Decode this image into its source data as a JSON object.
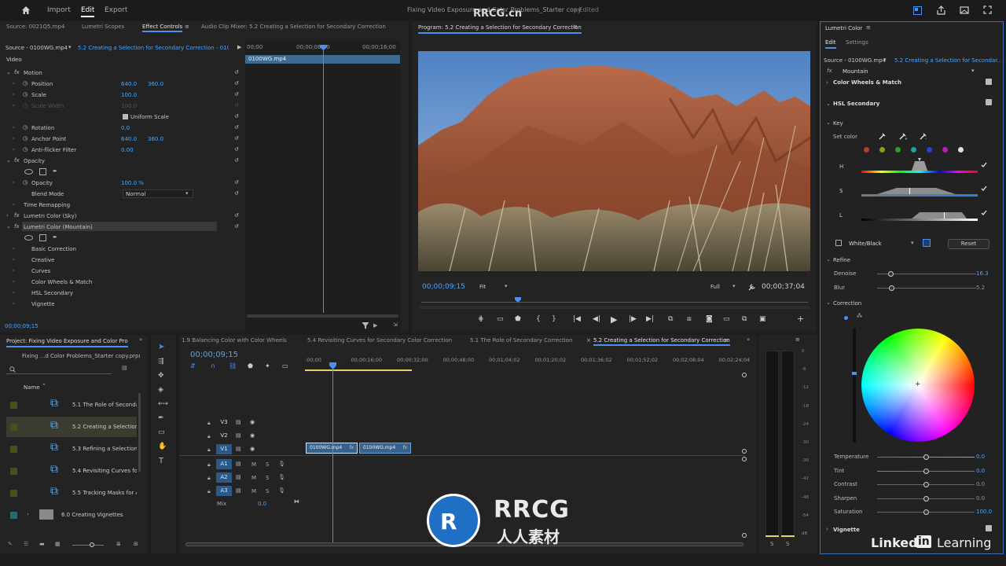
{
  "topbar": {
    "tabs": [
      "Import",
      "Edit",
      "Export"
    ],
    "active_tab": "Edit",
    "title": "Fixing Video Exposure and Color Problems_Starter copy",
    "title_status": "- Edited",
    "watermark": "RRCG.cn"
  },
  "source_panel": {
    "tabs": [
      "Source: 0021Q5.mp4",
      "Lumetri Scopes",
      "Effect Controls",
      "Audio Clip Mixer: 5.2 Creating a Selection for Secondary Correction"
    ],
    "active_tab": "Effect Controls",
    "source_label": "Source - 0100WG.mp4",
    "sequence_label": "5.2 Creating a Selection for Secondary Correction - 0100...",
    "ruler": [
      "00;00",
      "00;00;08;00",
      "00;00;16;00"
    ],
    "clip_name": "0100WG.mp4",
    "section_video": "Video",
    "rows": [
      {
        "label": "Motion",
        "fx": true,
        "value": "",
        "value2": ""
      },
      {
        "label": "Position",
        "value": "640.0",
        "value2": "360.0"
      },
      {
        "label": "Scale",
        "value": "100.0",
        "value2": ""
      },
      {
        "label": "Scale Width",
        "value": "100.0",
        "value2": "",
        "disabled": true
      },
      {
        "label": "Uniform Scale",
        "value": "",
        "value2": ""
      },
      {
        "label": "Rotation",
        "value": "0.0",
        "value2": ""
      },
      {
        "label": "Anchor Point",
        "value": "640.0",
        "value2": "360.0"
      },
      {
        "label": "Anti-flicker Filter",
        "value": "0.00",
        "value2": ""
      },
      {
        "label": "Opacity",
        "fx": true,
        "value": "",
        "value2": ""
      },
      {
        "label": "Opacity",
        "value": "100.0 %",
        "value2": ""
      },
      {
        "label": "Blend Mode",
        "value": "Normal",
        "value2": ""
      },
      {
        "label": "Time Remapping",
        "value": "",
        "value2": ""
      },
      {
        "label": "Lumetri Color (Sky)",
        "fx": true,
        "value": "",
        "value2": ""
      },
      {
        "label": "Lumetri Color (Mountain)",
        "fx": true,
        "value": "",
        "value2": ""
      },
      {
        "label": "Basic Correction",
        "value": "",
        "value2": ""
      },
      {
        "label": "Creative",
        "value": "",
        "value2": ""
      },
      {
        "label": "Curves",
        "value": "",
        "value2": ""
      },
      {
        "label": "Color Wheels & Match",
        "value": "",
        "value2": ""
      },
      {
        "label": "HSL Secondary",
        "value": "",
        "value2": ""
      },
      {
        "label": "Vignette",
        "value": "",
        "value2": ""
      }
    ],
    "timecode": "00;00;09;15"
  },
  "program_panel": {
    "title": "Program: 5.2 Creating a Selection for Secondary Correction",
    "timecode": "00;00;09;15",
    "fit": "Fit",
    "quality": "Full",
    "duration": "00;00;37;04"
  },
  "lumetri": {
    "title": "Lumetri Color",
    "tabs": [
      "Edit",
      "Settings"
    ],
    "active_tab": "Edit",
    "source_label": "Source - 0100WG.mp4",
    "sequence_label": "5.2 Creating a Selection for Secondar...",
    "fx_name": "Mountain",
    "sections": {
      "color_wheels": "Color Wheels & Match",
      "hsl": "HSL Secondary",
      "key": "Key",
      "set_color": "Set color",
      "h": "H",
      "s": "S",
      "l": "L",
      "white_black": "White/Black",
      "reset": "Reset",
      "refine": "Refine",
      "denoise": "Denoise",
      "denoise_value": "16.3",
      "blur": "Blur",
      "blur_value": "5.2",
      "correction": "Correction",
      "vignette": "Vignette"
    },
    "swatches": [
      "#c0392b",
      "#9a9a1a",
      "#2aa02a",
      "#1fa3a0",
      "#2244dd",
      "#b21fbf",
      "#e0e0e0"
    ],
    "sliders": [
      {
        "label": "Temperature",
        "value": "0.0",
        "fill": 0.5
      },
      {
        "label": "Tint",
        "value": "0.0",
        "fill": 0.5
      },
      {
        "label": "Contrast",
        "value": "0.0",
        "fill": 0.5
      },
      {
        "label": "Sharpen",
        "value": "0.0",
        "fill": 0.5
      },
      {
        "label": "Saturation",
        "value": "100.0",
        "fill": 0.5
      }
    ]
  },
  "project_panel": {
    "title": "Project: Fixing Video Exposure and Color Probl",
    "file": "Fixing ...d Color Problems_Starter copy.prproj",
    "column_name": "Name",
    "items": [
      {
        "label": "5.1 The Role of Seconda",
        "type": "sequence"
      },
      {
        "label": "5.2 Creating a Selection",
        "type": "sequence",
        "selected": true
      },
      {
        "label": "5.3 Refining a Selection",
        "type": "sequence"
      },
      {
        "label": "5.4 Revisiting Curves for",
        "type": "sequence"
      },
      {
        "label": "5.5 Tracking Masks for A",
        "type": "sequence"
      },
      {
        "label": "6.0 Creating Vignettes",
        "type": "folder"
      }
    ]
  },
  "timeline": {
    "tabs": [
      "1.9 Balancing Color with Color Wheels",
      "5.4 Revisiting Curves for Secondary Color Correction",
      "5.1 The Role of Secondary Correction",
      "5.2 Creating a Selection for Secondary Correction"
    ],
    "active_tab": "5.2 Creating a Selection for Secondary Correction",
    "timecode": "00;00;09;15",
    "ruler": [
      ":00;00",
      "00;00;16;00",
      "00;00;32;00",
      "00;00;48;00",
      "00;01;04;02",
      "00;01;20;02",
      "00;01;36;02",
      "00;01;52;02",
      "00;02;08;04",
      "00;02;24;04"
    ],
    "video_tracks": [
      "V3",
      "V2",
      "V1"
    ],
    "audio_tracks": [
      "A1",
      "A2",
      "A3"
    ],
    "mix_label": "Mix",
    "mix_value": "0.0",
    "clips": [
      "0100WG.mp4",
      "0100WG.mp4"
    ],
    "meter_scale": [
      "0",
      "-6",
      "-12",
      "-18",
      "-24",
      "-30",
      "-36",
      "-42",
      "-48",
      "-54",
      "dB"
    ],
    "meter_solo": [
      "S",
      "S"
    ]
  },
  "branding": {
    "rrcg": "RRCG",
    "rrcg_cn": "人人素材",
    "linkedin": "Linked",
    "linkedin_in": "in",
    "learning": "Learning"
  }
}
